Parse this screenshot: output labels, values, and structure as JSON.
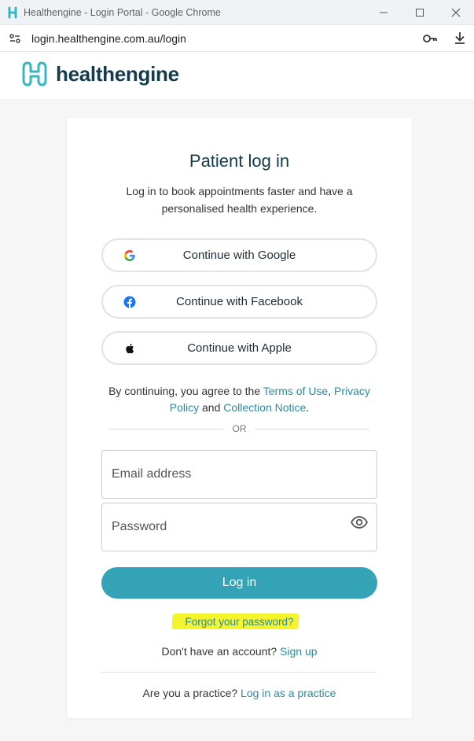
{
  "window": {
    "title": "Healthengine - Login Portal - Google Chrome"
  },
  "browser": {
    "url": "login.healthengine.com.au/login"
  },
  "header": {
    "brand": "healthengine"
  },
  "login": {
    "title": "Patient log in",
    "subtitle": "Log in to book appointments faster and have a personalised health experience.",
    "google_label": "Continue with Google",
    "facebook_label": "Continue with Facebook",
    "apple_label": "Continue with Apple",
    "terms_prefix": "By continuing, you agree to the ",
    "terms_link": "Terms of Use",
    "terms_sep": ", ",
    "privacy_link": "Privacy Policy",
    "terms_and": " and ",
    "collection_link": "Collection Notice",
    "terms_suffix": ".",
    "or_label": "OR",
    "email_placeholder": "Email address",
    "password_placeholder": "Password",
    "login_label": "Log in",
    "forgot_label": "Forgot your password?",
    "signup_prompt": "Don't have an account? ",
    "signup_link": "Sign up",
    "practice_prompt": "Are you a practice? ",
    "practice_link": "Log in as a practice"
  },
  "colors": {
    "accent": "#35a3b6",
    "link": "#2b8aa1",
    "brand_dark": "#133b4c",
    "highlight": "#f4f42c"
  },
  "icons": {
    "favicon": "healthengine-logo-icon",
    "site_info": "tune-icon",
    "password_manager": "key-icon",
    "download": "download-icon",
    "google": "google-icon",
    "facebook": "facebook-icon",
    "apple": "apple-icon",
    "show_password": "eye-icon"
  }
}
